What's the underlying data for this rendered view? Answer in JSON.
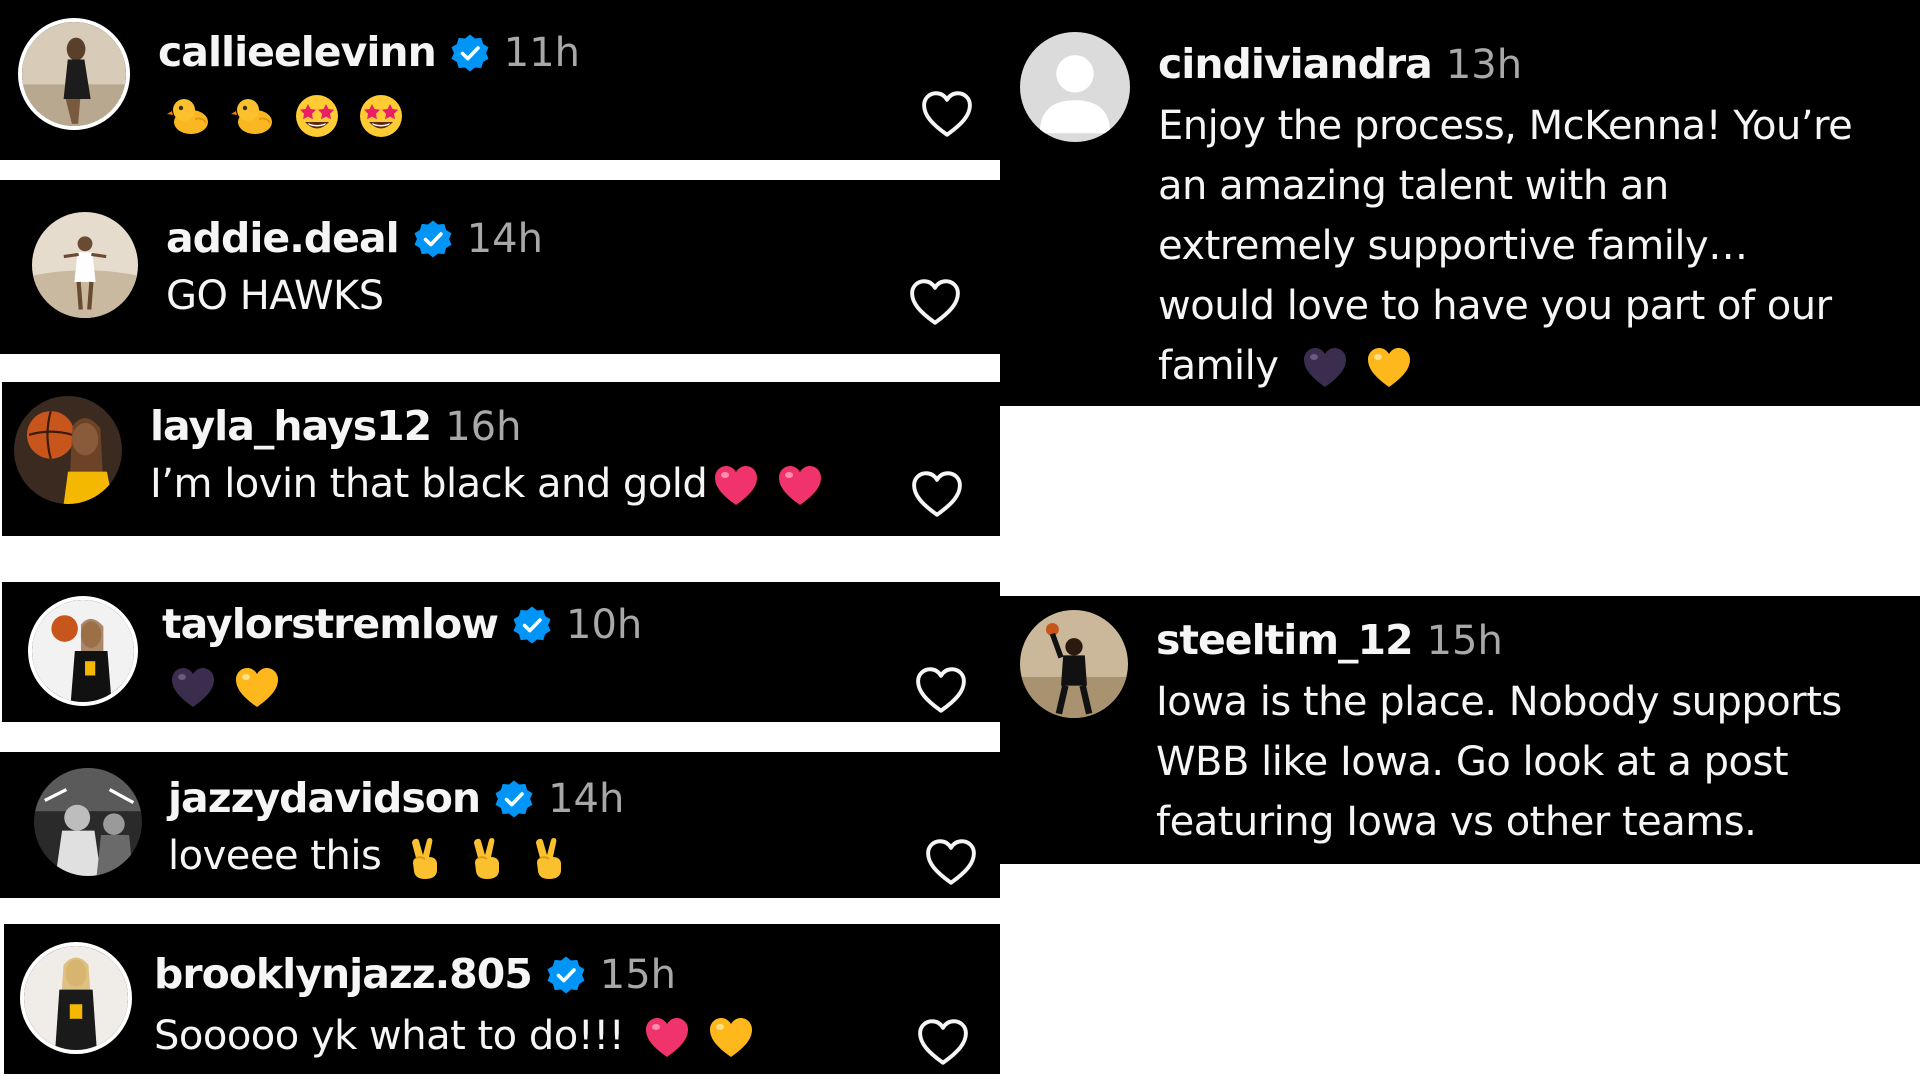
{
  "comments": [
    {
      "username": "callieelevinn",
      "verified": true,
      "time": "11h",
      "text": "",
      "emojis": [
        "chick-emoji",
        "chick-emoji",
        "star-struck-emoji",
        "star-struck-emoji"
      ]
    },
    {
      "username": "addie.deal",
      "verified": true,
      "time": "14h",
      "text": "GO HAWKS",
      "emojis": []
    },
    {
      "username": "layla_hays12",
      "verified": false,
      "time": "16h",
      "text": "I’m lovin that black and gold",
      "emojis": [
        "pink-heart-emoji",
        "pink-heart-emoji"
      ]
    },
    {
      "username": "taylorstremlow",
      "verified": true,
      "time": "10h",
      "text": "",
      "emojis": [
        "black-heart-emoji",
        "yellow-heart-emoji"
      ]
    },
    {
      "username": "jazzydavidson",
      "verified": true,
      "time": "14h",
      "text": "loveee this",
      "emojis": [
        "victory-hand-emoji",
        "victory-hand-emoji",
        "victory-hand-emoji"
      ]
    },
    {
      "username": "brooklynjazz.805",
      "verified": true,
      "time": "15h",
      "text": "Sooooo yk what to do!!!",
      "emojis": [
        "pink-heart-emoji",
        "yellow-heart-emoji"
      ]
    },
    {
      "username": "cindiviandra",
      "verified": false,
      "time": "13h",
      "text_lines": [
        "Enjoy the process, McKenna! You’re",
        "an amazing talent with an",
        "extremely supportive family…",
        "would love to have you part of our",
        "family"
      ],
      "emojis": [
        "black-heart-emoji",
        "yellow-heart-emoji"
      ]
    },
    {
      "username": "steeltim_12",
      "verified": false,
      "time": "15h",
      "text_lines": [
        "Iowa is the place. Nobody supports",
        "WBB like Iowa. Go look at a post",
        "featuring Iowa vs other teams."
      ],
      "emojis": []
    }
  ],
  "icons": {
    "like": "heart-outline-icon",
    "verified": "verified-badge-icon",
    "default_avatar": "default-avatar-icon"
  },
  "colors": {
    "card_background": "#000000",
    "page_background": "#ffffff",
    "username": "#f5f5f5",
    "timestamp": "#a8a8a8",
    "verified_badge": "#0095f6"
  }
}
